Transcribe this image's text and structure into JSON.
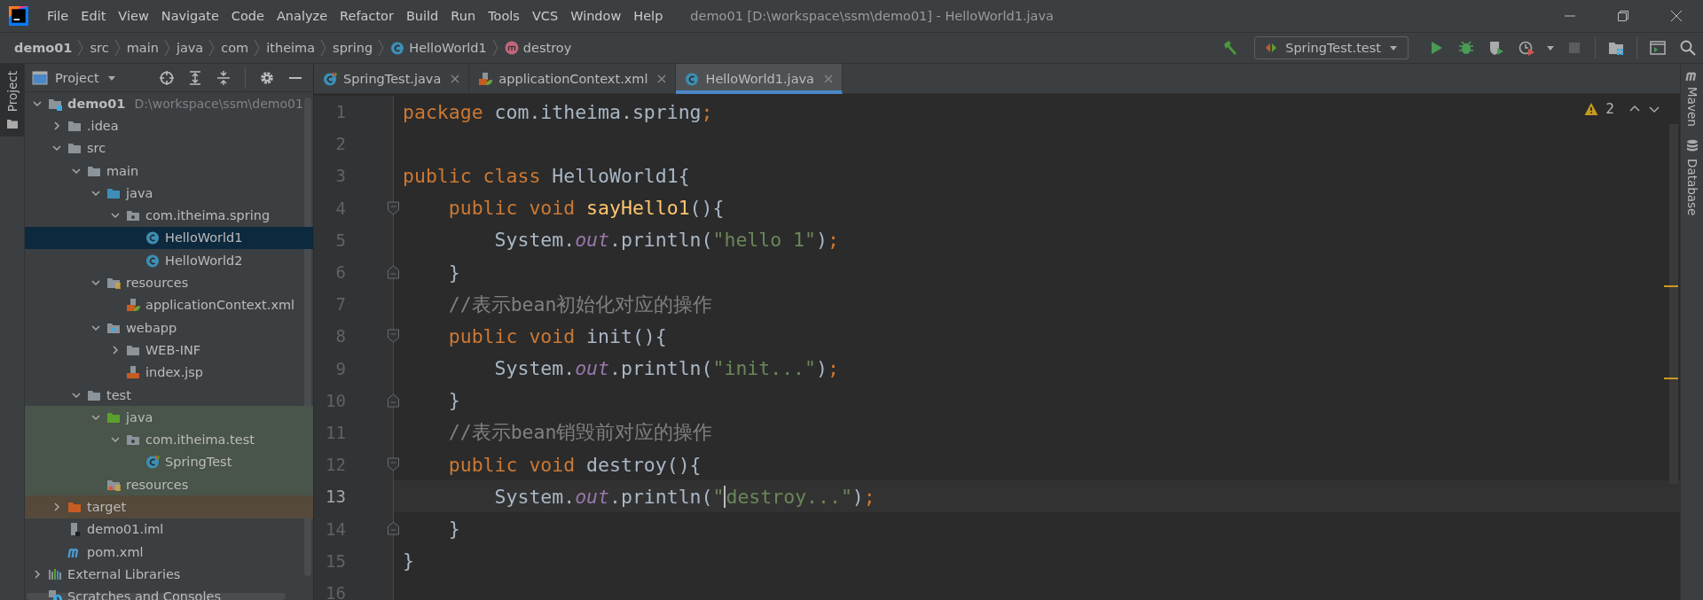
{
  "window": {
    "title": "demo01 [D:\\workspace\\ssm\\demo01] - HelloWorld1.java"
  },
  "menu": [
    "File",
    "Edit",
    "View",
    "Navigate",
    "Code",
    "Analyze",
    "Refactor",
    "Build",
    "Run",
    "Tools",
    "VCS",
    "Window",
    "Help"
  ],
  "breadcrumbs": [
    {
      "label": "demo01",
      "kind": "module"
    },
    {
      "label": "src",
      "kind": "folder"
    },
    {
      "label": "main",
      "kind": "folder"
    },
    {
      "label": "java",
      "kind": "folder"
    },
    {
      "label": "com",
      "kind": "folder"
    },
    {
      "label": "itheima",
      "kind": "folder"
    },
    {
      "label": "spring",
      "kind": "folder"
    },
    {
      "label": "HelloWorld1",
      "kind": "class"
    },
    {
      "label": "destroy",
      "kind": "method"
    }
  ],
  "toolbar": {
    "run_configuration": "SpringTest.test",
    "stop_disabled": true
  },
  "left_strip": [
    {
      "label": "Project",
      "selected": true
    }
  ],
  "project": {
    "title": "Project",
    "tree": [
      {
        "label": "demo01",
        "hint": "D:\\workspace\\ssm\\demo01",
        "kind": "module",
        "expanded": true,
        "selected": false,
        "children": [
          {
            "label": ".idea",
            "kind": "folder",
            "expanded": false,
            "selected": false
          },
          {
            "label": "src",
            "kind": "folder",
            "expanded": true,
            "selected": false,
            "children": [
              {
                "label": "main",
                "kind": "folder",
                "expanded": true,
                "selected": false,
                "children": [
                  {
                    "label": "java",
                    "kind": "source-root",
                    "expanded": true,
                    "selected": false,
                    "children": [
                      {
                        "label": "com.itheima.spring",
                        "kind": "package",
                        "expanded": true,
                        "selected": false,
                        "children": [
                          {
                            "label": "HelloWorld1",
                            "kind": "class",
                            "selected": true
                          },
                          {
                            "label": "HelloWorld2",
                            "kind": "class",
                            "selected": false
                          }
                        ]
                      }
                    ]
                  },
                  {
                    "label": "resources",
                    "kind": "resources",
                    "expanded": true,
                    "selected": false,
                    "children": [
                      {
                        "label": "applicationContext.xml",
                        "kind": "xml",
                        "selected": false
                      }
                    ]
                  },
                  {
                    "label": "webapp",
                    "kind": "webapp",
                    "expanded": true,
                    "selected": false,
                    "children": [
                      {
                        "label": "WEB-INF",
                        "kind": "folder",
                        "expanded": false,
                        "selected": false
                      },
                      {
                        "label": "index.jsp",
                        "kind": "jsp",
                        "selected": false
                      }
                    ]
                  }
                ]
              },
              {
                "label": "test",
                "kind": "folder",
                "expanded": true,
                "selected": false,
                "children": [
                  {
                    "label": "java",
                    "kind": "test-root",
                    "expanded": true,
                    "selected": false,
                    "test_scope": true,
                    "children": [
                      {
                        "label": "com.itheima.test",
                        "kind": "package",
                        "expanded": true,
                        "selected": false,
                        "test_scope": true,
                        "children": [
                          {
                            "label": "SpringTest",
                            "kind": "test-class",
                            "selected": false,
                            "test_scope": true
                          }
                        ]
                      }
                    ]
                  },
                  {
                    "label": "resources",
                    "kind": "test-resources",
                    "selected": false,
                    "test_scope": true
                  }
                ]
              }
            ]
          },
          {
            "label": "target",
            "kind": "excluded",
            "expanded": false,
            "selected": false,
            "excluded": true
          },
          {
            "label": "demo01.iml",
            "kind": "iml",
            "selected": false
          },
          {
            "label": "pom.xml",
            "kind": "maven",
            "selected": false
          }
        ]
      },
      {
        "label": "External Libraries",
        "kind": "libraries",
        "expanded": false,
        "selected": false
      },
      {
        "label": "Scratches and Consoles",
        "kind": "scratches",
        "selected": false
      }
    ]
  },
  "tabs": [
    {
      "label": "SpringTest.java",
      "kind": "test-class",
      "selected": false
    },
    {
      "label": "applicationContext.xml",
      "kind": "xml",
      "selected": false
    },
    {
      "label": "HelloWorld1.java",
      "kind": "class",
      "selected": true
    }
  ],
  "editor": {
    "warnings": "2",
    "lines": [
      {
        "number": "1",
        "current": false,
        "tokens": [
          {
            "text": "package ",
            "kind": "keyword"
          },
          {
            "text": "com.itheima.spring",
            "kind": "plain"
          },
          {
            "text": ";",
            "kind": "semicolon"
          }
        ]
      },
      {
        "number": "2",
        "current": false
      },
      {
        "number": "3",
        "current": false,
        "tokens": [
          {
            "text": "public class ",
            "kind": "keyword"
          },
          {
            "text": "HelloWorld1{",
            "kind": "plain"
          }
        ]
      },
      {
        "number": "4",
        "current": false,
        "fold_start": true,
        "tokens": [
          {
            "text": "    public void ",
            "kind": "keyword"
          },
          {
            "text": "sayHello1",
            "kind": "method"
          },
          {
            "text": "(){",
            "kind": "plain"
          }
        ]
      },
      {
        "number": "5",
        "current": false,
        "tokens": [
          {
            "text": "        System.",
            "kind": "plain"
          },
          {
            "text": "out",
            "kind": "field"
          },
          {
            "text": ".println(",
            "kind": "plain"
          },
          {
            "text": "\"hello 1\"",
            "kind": "string"
          },
          {
            "text": ")",
            "kind": "plain"
          },
          {
            "text": ";",
            "kind": "semicolon"
          }
        ]
      },
      {
        "number": "6",
        "current": false,
        "fold_end": true,
        "tokens": [
          {
            "text": "    }",
            "kind": "plain"
          }
        ]
      },
      {
        "number": "7",
        "current": false,
        "tokens": [
          {
            "text": "    //表示bean初始化对应的操作",
            "kind": "comment"
          }
        ]
      },
      {
        "number": "8",
        "current": false,
        "fold_start": true,
        "tokens": [
          {
            "text": "    public void ",
            "kind": "keyword"
          },
          {
            "text": "init(){",
            "kind": "plain"
          }
        ]
      },
      {
        "number": "9",
        "current": false,
        "tokens": [
          {
            "text": "        System.",
            "kind": "plain"
          },
          {
            "text": "out",
            "kind": "field"
          },
          {
            "text": ".println(",
            "kind": "plain"
          },
          {
            "text": "\"init...\"",
            "kind": "string"
          },
          {
            "text": ")",
            "kind": "plain"
          },
          {
            "text": ";",
            "kind": "semicolon"
          }
        ]
      },
      {
        "number": "10",
        "current": false,
        "fold_end": true,
        "tokens": [
          {
            "text": "    }",
            "kind": "plain"
          }
        ]
      },
      {
        "number": "11",
        "current": false,
        "tokens": [
          {
            "text": "    //表示bean销毁前对应的操作",
            "kind": "comment"
          }
        ]
      },
      {
        "number": "12",
        "current": false,
        "fold_start": true,
        "tokens": [
          {
            "text": "    public void ",
            "kind": "keyword"
          },
          {
            "text": "destroy(){",
            "kind": "plain"
          }
        ]
      },
      {
        "number": "13",
        "current": true,
        "tokens": [
          {
            "text": "        System.",
            "kind": "plain"
          },
          {
            "text": "out",
            "kind": "field"
          },
          {
            "text": ".println(",
            "kind": "plain"
          },
          {
            "text": "\"",
            "kind": "string"
          },
          {
            "text": "destroy...\"",
            "kind": "string",
            "caret": true
          },
          {
            "text": ")",
            "kind": "plain"
          },
          {
            "text": ";",
            "kind": "semicolon"
          }
        ]
      },
      {
        "number": "14",
        "current": false,
        "fold_end": true,
        "tokens": [
          {
            "text": "    }",
            "kind": "plain"
          }
        ]
      },
      {
        "number": "15",
        "current": false,
        "tokens": [
          {
            "text": "}",
            "kind": "plain"
          }
        ]
      },
      {
        "number": "16",
        "current": false
      }
    ]
  },
  "right_strip": [
    {
      "label": "Maven",
      "kind": "maven"
    },
    {
      "label": "Database",
      "kind": "database"
    }
  ]
}
